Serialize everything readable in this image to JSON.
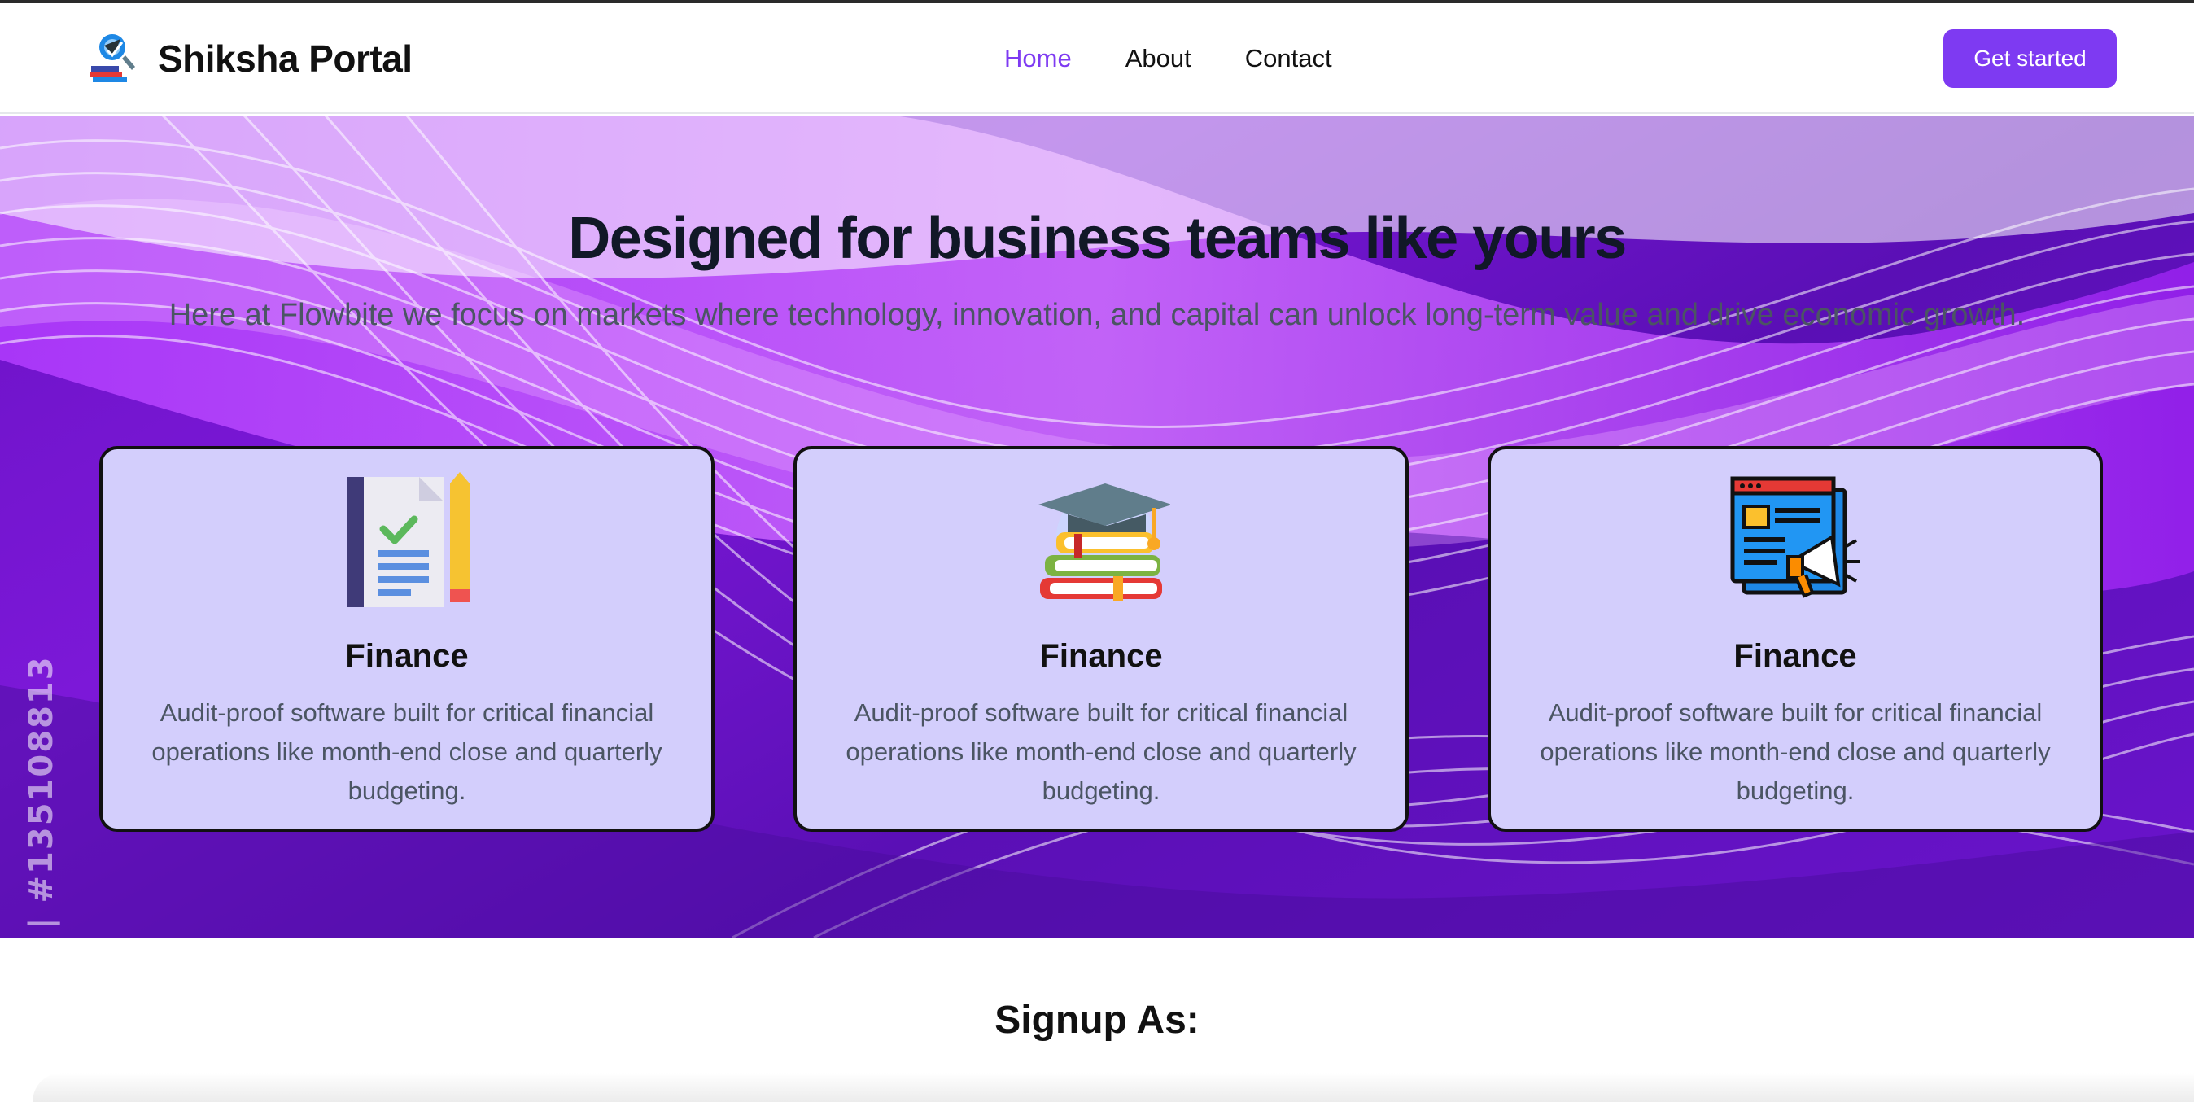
{
  "navbar": {
    "brand_name": "Shiksha Portal",
    "links": [
      {
        "label": "Home",
        "active": true
      },
      {
        "label": "About",
        "active": false
      },
      {
        "label": "Contact",
        "active": false
      }
    ],
    "cta_label": "Get started",
    "accent_color": "#7e3af2"
  },
  "hero": {
    "title": "Designed for business teams like yours",
    "subtitle": "Here at Flowbite we focus on markets where technology, innovation, and capital can unlock long-term value and drive economic growth.",
    "watermark": "| #135108813",
    "cards": [
      {
        "icon": "document-checklist-icon",
        "title": "Finance",
        "description": "Audit-proof software built for critical financial operations like month-end close and quarterly budgeting."
      },
      {
        "icon": "graduation-books-icon",
        "title": "Finance",
        "description": "Audit-proof software built for critical financial operations like month-end close and quarterly budgeting."
      },
      {
        "icon": "news-megaphone-icon",
        "title": "Finance",
        "description": "Audit-proof software built for critical financial operations like month-end close and quarterly budgeting."
      }
    ]
  },
  "signup": {
    "title": "Signup As:"
  }
}
